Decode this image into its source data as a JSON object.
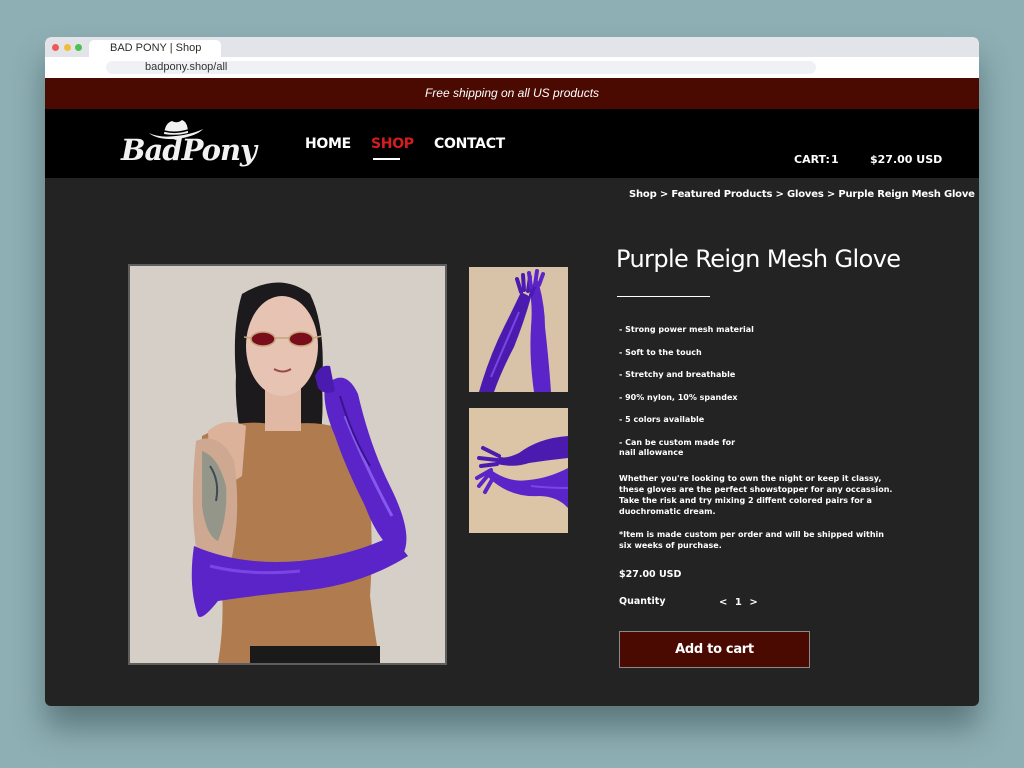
{
  "browser": {
    "tab_title": "BAD PONY | Shop",
    "url": "badpony.shop/all"
  },
  "announcement": "Free shipping on all US products",
  "header": {
    "logo_text": "BadPony",
    "nav": [
      {
        "label": "HOME"
      },
      {
        "label": "SHOP"
      },
      {
        "label": "CONTACT"
      }
    ],
    "cart_label": "CART:",
    "cart_count": "1",
    "cart_total": "$27.00 USD"
  },
  "breadcrumb": [
    {
      "label": "Shop"
    },
    {
      "label": "Featured Products"
    },
    {
      "label": "Gloves"
    },
    {
      "label": "Purple Reign Mesh Glove"
    }
  ],
  "breadcrumb_separator": ">",
  "product": {
    "title": "Purple Reign Mesh Glove",
    "features": [
      "- Strong power mesh material",
      "- Soft to the touch",
      "- Stretchy and breathable",
      "- 90% nylon, 10% spandex",
      "- 5 colors available",
      "- Can be custom made for nail allowance"
    ],
    "description": [
      "Whether you're looking to own the night or keep it classy, these gloves are the perfect showstopper for any occassion. Take the risk and try mixing 2 diffent colored pairs for a duochromatic dream.",
      "*Item is made custom per order and will be shipped within six weeks of purchase."
    ],
    "price": "$27.00 USD",
    "quantity_label": "Quantity",
    "quantity_dec": "<",
    "quantity": "1",
    "quantity_inc": ">",
    "add_to_cart": "Add to cart"
  },
  "colors": {
    "accent": "#4a0a02",
    "nav_active": "#d41d1d",
    "glove_purple": "#5a24c8"
  }
}
